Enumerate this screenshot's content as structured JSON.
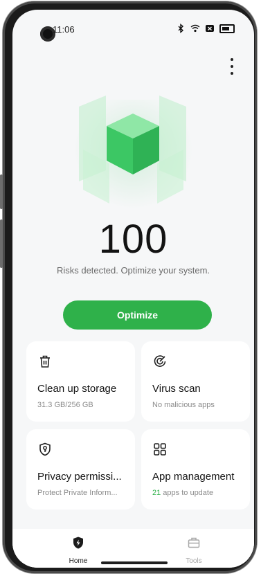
{
  "status_bar": {
    "time": "11:06"
  },
  "hero": {
    "score": "100",
    "message": "Risks detected. Optimize your system."
  },
  "actions": {
    "optimize_label": "Optimize"
  },
  "cards": [
    {
      "title": "Clean up storage",
      "subtitle": "31.3 GB/256 GB",
      "icon": "trash-icon"
    },
    {
      "title": "Virus scan",
      "subtitle": "No malicious apps",
      "icon": "virus-scan-icon"
    },
    {
      "title": "Privacy permissi...",
      "subtitle": "Protect Private Inform...",
      "icon": "privacy-shield-icon"
    },
    {
      "title": "App management",
      "subtitle_count": "21",
      "subtitle_rest": " apps to update",
      "icon": "apps-grid-icon"
    }
  ],
  "nav": {
    "home_label": "Home",
    "tools_label": "Tools"
  },
  "colors": {
    "accent": "#2fb14a",
    "background": "#f6f7f8"
  }
}
